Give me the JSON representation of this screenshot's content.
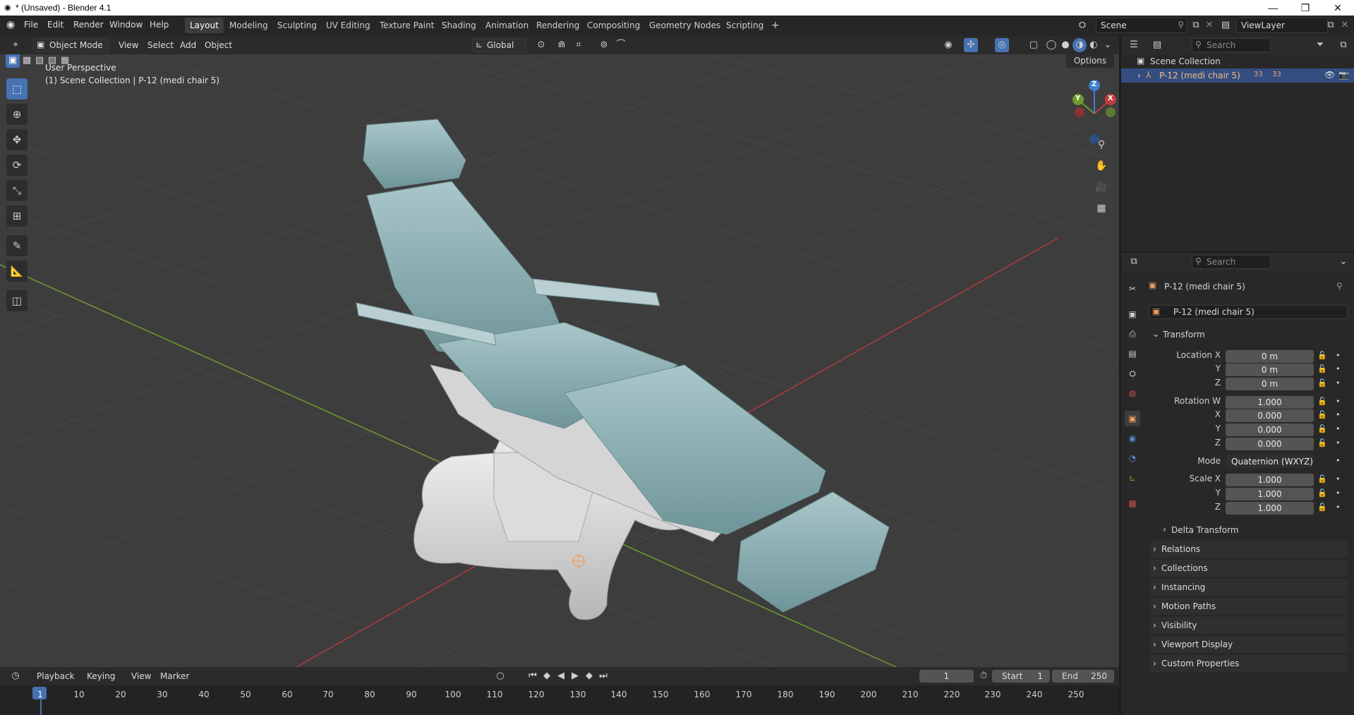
{
  "window": {
    "title": "* (Unsaved) - Blender 4.1",
    "minimize": "—",
    "restore": "❐",
    "close": "✕"
  },
  "menu": {
    "file": "File",
    "edit": "Edit",
    "render": "Render",
    "window": "Window",
    "help": "Help"
  },
  "workspaces": [
    "Layout",
    "Modeling",
    "Sculpting",
    "UV Editing",
    "Texture Paint",
    "Shading",
    "Animation",
    "Rendering",
    "Compositing",
    "Geometry Nodes",
    "Scripting"
  ],
  "active_workspace": "Layout",
  "add_workspace": "+",
  "scene": {
    "name": "Scene",
    "view_layer": "ViewLayer"
  },
  "viewport_header": {
    "mode": "Object Mode",
    "view": "View",
    "select": "Select",
    "add": "Add",
    "object": "Object",
    "orientation": "Global",
    "options": "Options"
  },
  "viewport": {
    "perspective": "User Perspective",
    "collection_info": "(1) Scene Collection | P-12 (medi chair 5)"
  },
  "gizmo": {
    "x": "X",
    "y": "Y",
    "z": "Z"
  },
  "outliner": {
    "search_placeholder": "Search",
    "root": "Scene Collection",
    "object": "P-12 (medi chair 5)",
    "badge1": "33",
    "badge2": "33"
  },
  "properties": {
    "search_placeholder": "Search",
    "object_name": "P-12 (medi chair 5)",
    "datablock_name": "P-12 (medi chair 5)",
    "transform_title": "Transform",
    "location": {
      "label_x": "Location X",
      "label_y": "Y",
      "label_z": "Z",
      "x": "0 m",
      "y": "0 m",
      "z": "0 m"
    },
    "rotation": {
      "label_w": "Rotation W",
      "label_x": "X",
      "label_y": "Y",
      "label_z": "Z",
      "w": "1.000",
      "x": "0.000",
      "y": "0.000",
      "z": "0.000"
    },
    "mode": {
      "label": "Mode",
      "value": "Quaternion (WXYZ)"
    },
    "scale": {
      "label_x": "Scale X",
      "label_y": "Y",
      "label_z": "Z",
      "x": "1.000",
      "y": "1.000",
      "z": "1.000"
    },
    "delta": "Delta Transform",
    "panels": [
      "Relations",
      "Collections",
      "Instancing",
      "Motion Paths",
      "Visibility",
      "Viewport Display",
      "Custom Properties"
    ]
  },
  "timeline": {
    "playback": "Playback",
    "keying": "Keying",
    "view": "View",
    "marker": "Marker",
    "current_frame": "1",
    "start_label": "Start",
    "start": "1",
    "end_label": "End",
    "end": "250",
    "ticks": [
      "1",
      "10",
      "20",
      "30",
      "40",
      "50",
      "60",
      "70",
      "80",
      "90",
      "100",
      "110",
      "120",
      "130",
      "140",
      "150",
      "160",
      "170",
      "180",
      "190",
      "200",
      "210",
      "220",
      "230",
      "240",
      "250"
    ]
  },
  "colors": {
    "accent": "#4772b3",
    "selected_row": "#334d80",
    "object_name": "#e0a060",
    "chair_cushion": "#8fb2b6",
    "chair_base": "#d9d9d9",
    "x_axis": "#c03c3c",
    "y_axis": "#6f9a2e",
    "z_axis": "#3f7fd0"
  }
}
